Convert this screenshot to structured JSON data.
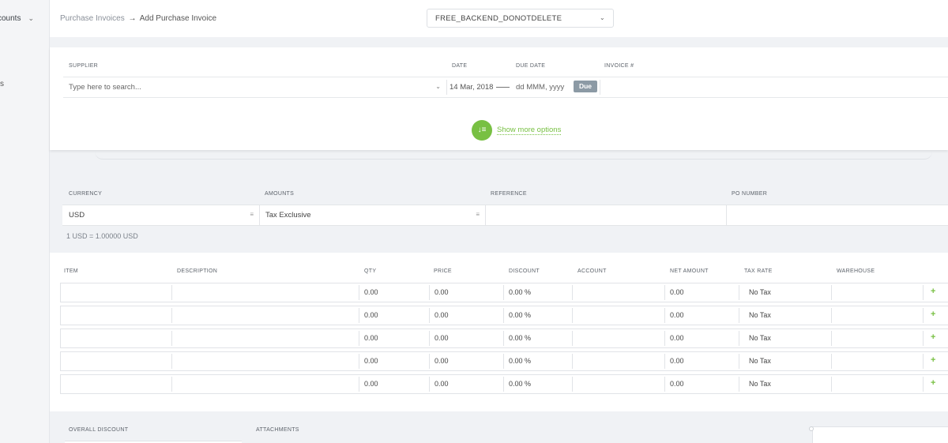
{
  "sidebar": {
    "top_label": "counts",
    "item2_label": "s"
  },
  "breadcrumb": {
    "parent": "Purchase Invoices",
    "separator": "→",
    "current": "Add Purchase Invoice"
  },
  "company_selector": {
    "value": "FREE_BACKEND_DONOTDELETE"
  },
  "header": {
    "supplier_label": "SUPPLIER",
    "date_label": "DATE",
    "due_date_label": "DUE DATE",
    "invoice_label": "INVOICE #",
    "supplier_placeholder": "Type here to search...",
    "date_value": "14 Mar, 2018",
    "due_date_placeholder": "dd MMM, yyyy",
    "due_button": "Due",
    "invoice_value": "",
    "show_more": "Show more options"
  },
  "currency_section": {
    "currency_label": "CURRENCY",
    "amounts_label": "AMOUNTS",
    "reference_label": "REFERENCE",
    "po_label": "PO NUMBER",
    "currency_value": "USD",
    "amounts_value": "Tax Exclusive",
    "reference_value": "",
    "po_value": "",
    "rate_text": "1 USD = 1.00000 USD"
  },
  "items": {
    "columns": [
      "ITEM",
      "DESCRIPTION",
      "QTY",
      "PRICE",
      "DISCOUNT",
      "ACCOUNT",
      "NET AMOUNT",
      "TAX RATE",
      "WAREHOUSE"
    ],
    "rows": [
      {
        "item": "",
        "description": "",
        "qty": "0.00",
        "price": "0.00",
        "discount": "0.00 %",
        "account": "",
        "net_amount": "0.00",
        "tax_rate": "No Tax",
        "warehouse": ""
      },
      {
        "item": "",
        "description": "",
        "qty": "0.00",
        "price": "0.00",
        "discount": "0.00 %",
        "account": "",
        "net_amount": "0.00",
        "tax_rate": "No Tax",
        "warehouse": ""
      },
      {
        "item": "",
        "description": "",
        "qty": "0.00",
        "price": "0.00",
        "discount": "0.00 %",
        "account": "",
        "net_amount": "0.00",
        "tax_rate": "No Tax",
        "warehouse": ""
      },
      {
        "item": "",
        "description": "",
        "qty": "0.00",
        "price": "0.00",
        "discount": "0.00 %",
        "account": "",
        "net_amount": "0.00",
        "tax_rate": "No Tax",
        "warehouse": ""
      },
      {
        "item": "",
        "description": "",
        "qty": "0.00",
        "price": "0.00",
        "discount": "0.00 %",
        "account": "",
        "net_amount": "0.00",
        "tax_rate": "No Tax",
        "warehouse": ""
      }
    ],
    "add_symbol": "+"
  },
  "footer": {
    "overall_discount_label": "OVERALL DISCOUNT",
    "attachments_label": "ATTACHMENTS"
  },
  "colors": {
    "accent_green": "#78c043",
    "due_badge": "#8c9aa5"
  }
}
